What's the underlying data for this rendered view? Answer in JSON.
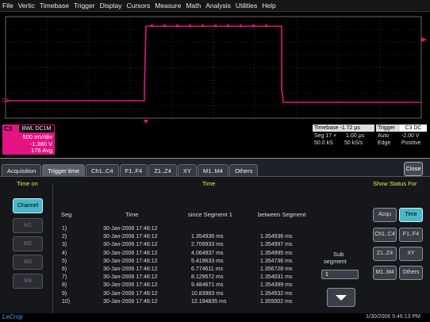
{
  "menu": [
    "File",
    "Vertic",
    "Timebase",
    "Trigger",
    "Display",
    "Cursors",
    "Measure",
    "Math",
    "Analysis",
    "Utilities",
    "Help"
  ],
  "channel": {
    "num": "C3",
    "mode": "BWL DC1M",
    "vdiv": "500 mV/div",
    "offset": "-1.380 V",
    "extra": "176 Avg"
  },
  "timebase": {
    "head": "Timebase -1.72 μs",
    "hdiv_label": "Seg 17 ×",
    "hdiv": "1.00 μs",
    "sr": "50.0 kS",
    "sr2": "50 kS/s",
    "trig_head": "Trigger",
    "trig_ch": "C3 DC",
    "trig_mode": "Auto",
    "trig_level": "-2.00 V",
    "trig_type": "Edge",
    "trig_slope": "Positive"
  },
  "tabs": [
    "Acquisition",
    "Trigger time",
    "Ch1..C4",
    "F1..F4",
    "Z1..Z4",
    "XY",
    "M1..M4",
    "Others"
  ],
  "active_tab": 1,
  "close_label": "Close",
  "section": {
    "time_on": "Time on",
    "time": "Time",
    "show_status": "Show Status For"
  },
  "left_buttons": [
    "Channel",
    "M1",
    "M2",
    "M3",
    "M4"
  ],
  "headers": {
    "seg": "Seg",
    "time": "Time",
    "since": "since Segment 1",
    "between": "between Segment"
  },
  "rows": [
    {
      "seg": "1)",
      "time": "30-Jan-2006 17:46:12",
      "since": "",
      "between": ""
    },
    {
      "seg": "2)",
      "time": "30-Jan-2006 17:46:12",
      "since": "1.354936 ms",
      "between": "1.354936 ms"
    },
    {
      "seg": "3)",
      "time": "30-Jan-2006 17:46:12",
      "since": "2.709933 ms",
      "between": "1.354997 ms"
    },
    {
      "seg": "4)",
      "time": "30-Jan-2006 17:46:12",
      "since": "4.064937 ms",
      "between": "1.354995 ms"
    },
    {
      "seg": "5)",
      "time": "30-Jan-2006 17:46:12",
      "since": "5.419633 ms",
      "between": "1.354736 ms"
    },
    {
      "seg": "6)",
      "time": "30-Jan-2006 17:46:12",
      "since": "6.774611 ms",
      "between": "1.356728 ms"
    },
    {
      "seg": "7)",
      "time": "30-Jan-2006 17:46:12",
      "since": "8.129572 ms",
      "between": "1.354031 ms"
    },
    {
      "seg": "8)",
      "time": "30-Jan-2006 17:46:12",
      "since": "9.484671 ms",
      "between": "1.354399 ms"
    },
    {
      "seg": "9)",
      "time": "30-Jan-2006 17:46:12",
      "since": "10.83983 ms",
      "between": "1.354532 ms"
    },
    {
      "seg": "10)",
      "time": "30-Jan-2006 17:46:12",
      "since": "12.194835 ms",
      "between": "1.355002 ms"
    }
  ],
  "sub_segment": {
    "label1": "Sub",
    "label2": "segment",
    "value": "1"
  },
  "right_buttons": [
    "Acqu",
    "Time",
    "Ch1..C4",
    "F1..F4",
    "Z1..Z4",
    "XY",
    "M1..M4",
    "Others"
  ],
  "footer": {
    "logo": "LeCroy",
    "clock": "1/30/2006 5:46:13 PM"
  },
  "colors": {
    "trace": "#e31383",
    "panel_bg": "#1e2228",
    "highlight": "#46b9c4",
    "label": "#ecec4a"
  }
}
